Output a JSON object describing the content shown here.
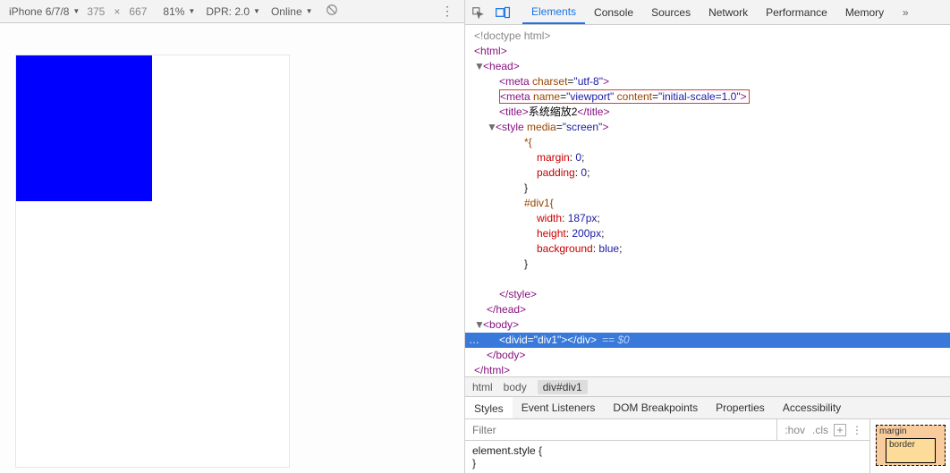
{
  "device_bar": {
    "device": "iPhone 6/7/8",
    "width": "375",
    "height": "667",
    "zoom": "81%",
    "dpr": "DPR: 2.0",
    "online": "Online"
  },
  "dev_tabs": [
    "Elements",
    "Console",
    "Sources",
    "Network",
    "Performance",
    "Memory"
  ],
  "dom": {
    "doctype": "<!doctype html>",
    "html_open": "html",
    "head_open": "head",
    "meta1_name": "meta",
    "meta1_a1": "charset",
    "meta1_v1": "utf-8",
    "meta2_name": "meta",
    "meta2_a1": "name",
    "meta2_v1": "viewport",
    "meta2_a2": "content",
    "meta2_v2": "initial-scale=1.0",
    "title_tag": "title",
    "title_text": "系统缩放2",
    "style_tag": "style",
    "style_attr": "media",
    "style_val": "screen",
    "rule1_sel": "*{",
    "rule1_p1": "margin",
    "rule1_v1": "0",
    "rule1_p2": "padding",
    "rule1_v2": "0",
    "rule2_sel": "#div1{",
    "rule2_p1": "width",
    "rule2_v1": "187px",
    "rule2_p2": "height",
    "rule2_v2": "200px",
    "rule2_p3": "background",
    "rule2_v3": "blue",
    "brace_close": "}",
    "style_close": "style",
    "head_close": "head",
    "body_open": "body",
    "div_tag": "div",
    "div_attr": "id",
    "div_val": "div1",
    "eq0": "== $0",
    "body_close": "body",
    "html_close": "html"
  },
  "crumbs": [
    "html",
    "body",
    "div#div1"
  ],
  "styles_tabs": [
    "Styles",
    "Event Listeners",
    "DOM Breakpoints",
    "Properties",
    "Accessibility"
  ],
  "filter_placeholder": "Filter",
  "filter_tools": {
    "hov": ":hov",
    "cls": ".cls",
    "plus": "+"
  },
  "styles_code": {
    "sel": "element.style",
    "open": " {",
    "close": "}"
  },
  "box_model": {
    "margin": "margin",
    "border": "border"
  }
}
